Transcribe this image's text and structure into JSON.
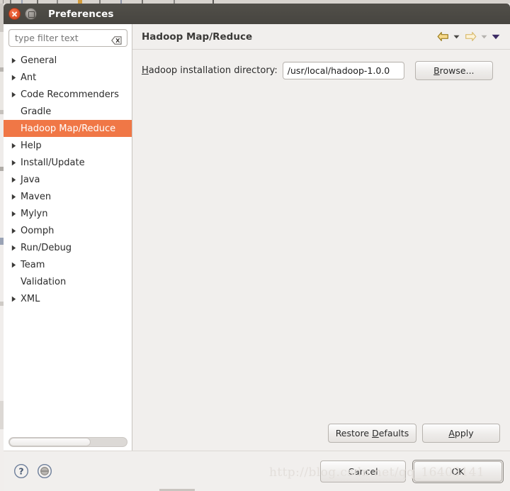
{
  "window": {
    "title": "Preferences",
    "close_icon": "close-icon",
    "maximize_icon": "maximize-icon",
    "titlebar_color": "#474540"
  },
  "sidebar": {
    "filter": {
      "placeholder": "type filter text",
      "value": "",
      "clear_icon": "clear-backspace-icon"
    },
    "selection_color": "#f07746",
    "items": [
      {
        "label": "General",
        "expandable": true,
        "selected": false
      },
      {
        "label": "Ant",
        "expandable": true,
        "selected": false
      },
      {
        "label": "Code Recommenders",
        "expandable": true,
        "selected": false
      },
      {
        "label": "Gradle",
        "expandable": false,
        "selected": false
      },
      {
        "label": "Hadoop Map/Reduce",
        "expandable": false,
        "selected": true
      },
      {
        "label": "Help",
        "expandable": true,
        "selected": false
      },
      {
        "label": "Install/Update",
        "expandable": true,
        "selected": false
      },
      {
        "label": "Java",
        "expandable": true,
        "selected": false
      },
      {
        "label": "Maven",
        "expandable": true,
        "selected": false
      },
      {
        "label": "Mylyn",
        "expandable": true,
        "selected": false
      },
      {
        "label": "Oomph",
        "expandable": true,
        "selected": false
      },
      {
        "label": "Run/Debug",
        "expandable": true,
        "selected": false
      },
      {
        "label": "Team",
        "expandable": true,
        "selected": false
      },
      {
        "label": "Validation",
        "expandable": false,
        "selected": false
      },
      {
        "label": "XML",
        "expandable": true,
        "selected": false
      }
    ],
    "hscroll": {
      "thumb_percent": 69
    }
  },
  "page": {
    "title": "Hadoop Map/Reduce",
    "nav": {
      "back_icon": "back-arrow-icon",
      "back_caret_icon": "chevron-down-icon",
      "forward_icon": "forward-arrow-icon",
      "forward_caret_icon": "chevron-down-icon",
      "menu_icon": "chevron-down-icon"
    },
    "field": {
      "label": "Hadoop installation directory:",
      "label_mnemonic": "H",
      "value": "/usr/local/hadoop-1.0.0",
      "placeholder": ""
    },
    "browse_label": "Browse...",
    "browse_mnemonic": "B",
    "restore_defaults_label": "Restore Defaults",
    "restore_defaults_mnemonic": "D",
    "apply_label": "Apply",
    "apply_mnemonic": "A"
  },
  "footer": {
    "help_icon": "help-question-icon",
    "tray_icon": "show-tray-circle-icon",
    "cancel_label": "Cancel",
    "ok_label": "OK"
  },
  "watermark": "http://blog.csdn.net/qq_16403141"
}
